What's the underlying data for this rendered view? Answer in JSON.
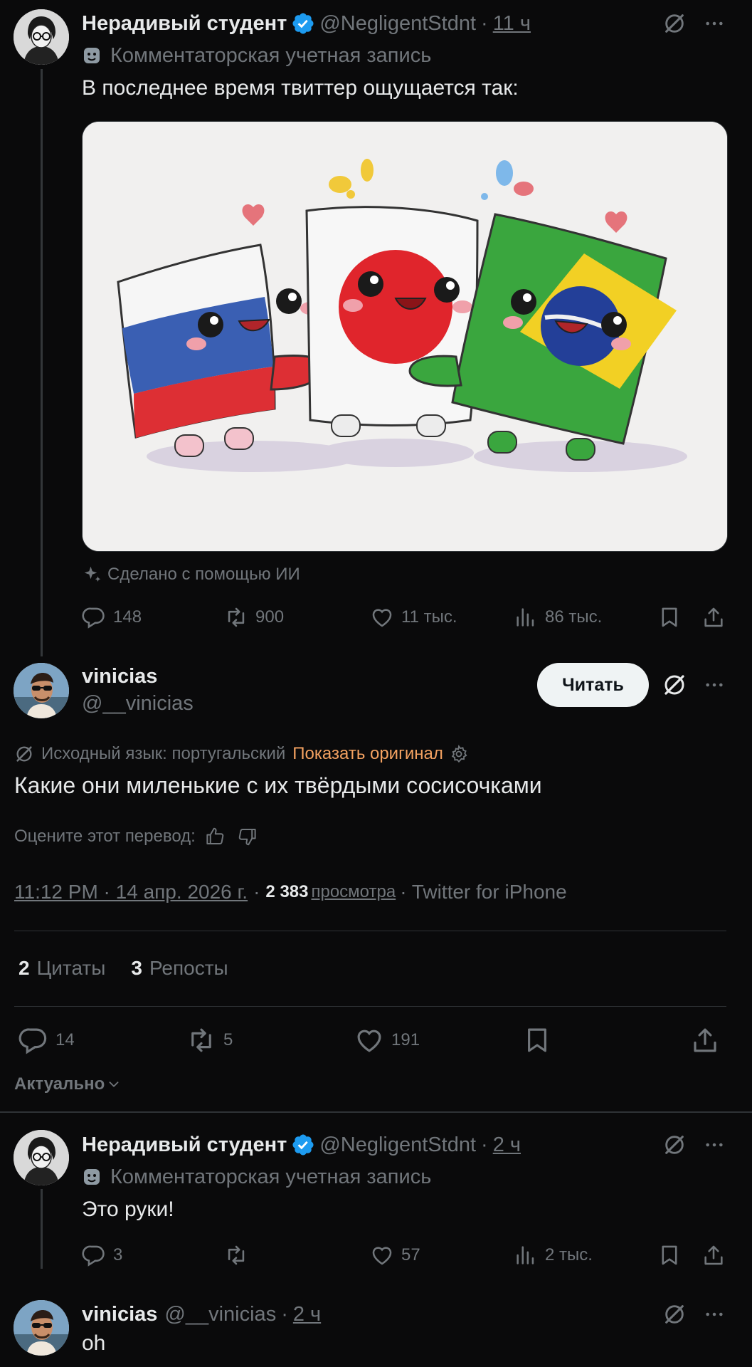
{
  "colors": {
    "background": "#0a0a0b",
    "text": "#e7e9ea",
    "muted": "#71767b",
    "accent_link": "#f4a261",
    "verified": "#1d9bf0"
  },
  "post1": {
    "name": "Нерадивый студент",
    "handle": "@NegligentStdnt",
    "sep": "·",
    "time": "11 ч",
    "label_icon": "theater-mask-icon",
    "label": "Комментаторская учетная запись",
    "text": "В последнее время твиттер ощущается так:",
    "image_alt": "Три мультяшных флага: Россия, Япония и Бразилия",
    "ai_note": "Сделано с помощью ИИ",
    "stats": {
      "replies": "148",
      "reposts": "900",
      "likes": "11 тыс.",
      "views": "86 тыс."
    }
  },
  "post2": {
    "name": "vinicias",
    "handle": "@__vinicias",
    "follow_label": "Читать",
    "translation_note": "Исходный язык: португальский",
    "show_original": "Показать оригинал",
    "text": "Какие они миленькие с их твёрдыми сосисочками",
    "rate_translation": "Оцените этот перевод:",
    "timestamp": "11:12 PM · 14 апр. 2026 г.",
    "sep": "·",
    "views_count": "2 383",
    "views_label": "просмотра",
    "source": "· Twitter for iPhone",
    "quotes_count": "2",
    "quotes_label": "Цитаты",
    "reposts_count": "3",
    "reposts_label": "Репосты",
    "stats": {
      "replies": "14",
      "reposts": "5",
      "likes": "191"
    }
  },
  "sort": {
    "label": "Актуально"
  },
  "reply1": {
    "name": "Нерадивый студент",
    "handle": "@NegligentStdnt",
    "sep": "·",
    "time": "2 ч",
    "label": "Комментаторская учетная запись",
    "text": "Это руки!",
    "stats": {
      "replies": "3",
      "reposts": "",
      "likes": "57",
      "views": "2 тыс."
    }
  },
  "reply2": {
    "name": "vinicias",
    "handle": "@__vinicias",
    "sep": "·",
    "time": "2 ч",
    "text": "oh"
  }
}
